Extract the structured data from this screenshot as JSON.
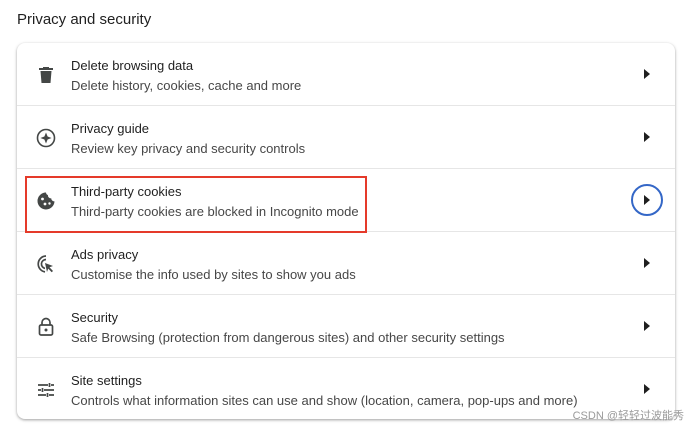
{
  "section": {
    "title": "Privacy and security"
  },
  "rows": [
    {
      "icon": "trash-icon",
      "title": "Delete browsing data",
      "subtitle": "Delete history, cookies, cache and more"
    },
    {
      "icon": "compass-icon",
      "title": "Privacy guide",
      "subtitle": "Review key privacy and security controls"
    },
    {
      "icon": "cookie-icon",
      "title": "Third-party cookies",
      "subtitle": "Third-party cookies are blocked in Incognito mode"
    },
    {
      "icon": "ads-privacy-icon",
      "title": "Ads privacy",
      "subtitle": "Customise the info used by sites to show you ads"
    },
    {
      "icon": "lock-icon",
      "title": "Security",
      "subtitle": "Safe Browsing (protection from dangerous sites) and other security settings"
    },
    {
      "icon": "tune-icon",
      "title": "Site settings",
      "subtitle": "Controls what information sites can use and show (location, camera, pop-ups and more)"
    }
  ],
  "colors": {
    "focus_ring": "#3467c7",
    "highlight_box": "#e53a2a"
  },
  "watermark": "CSDN @轻轻过波能秀"
}
